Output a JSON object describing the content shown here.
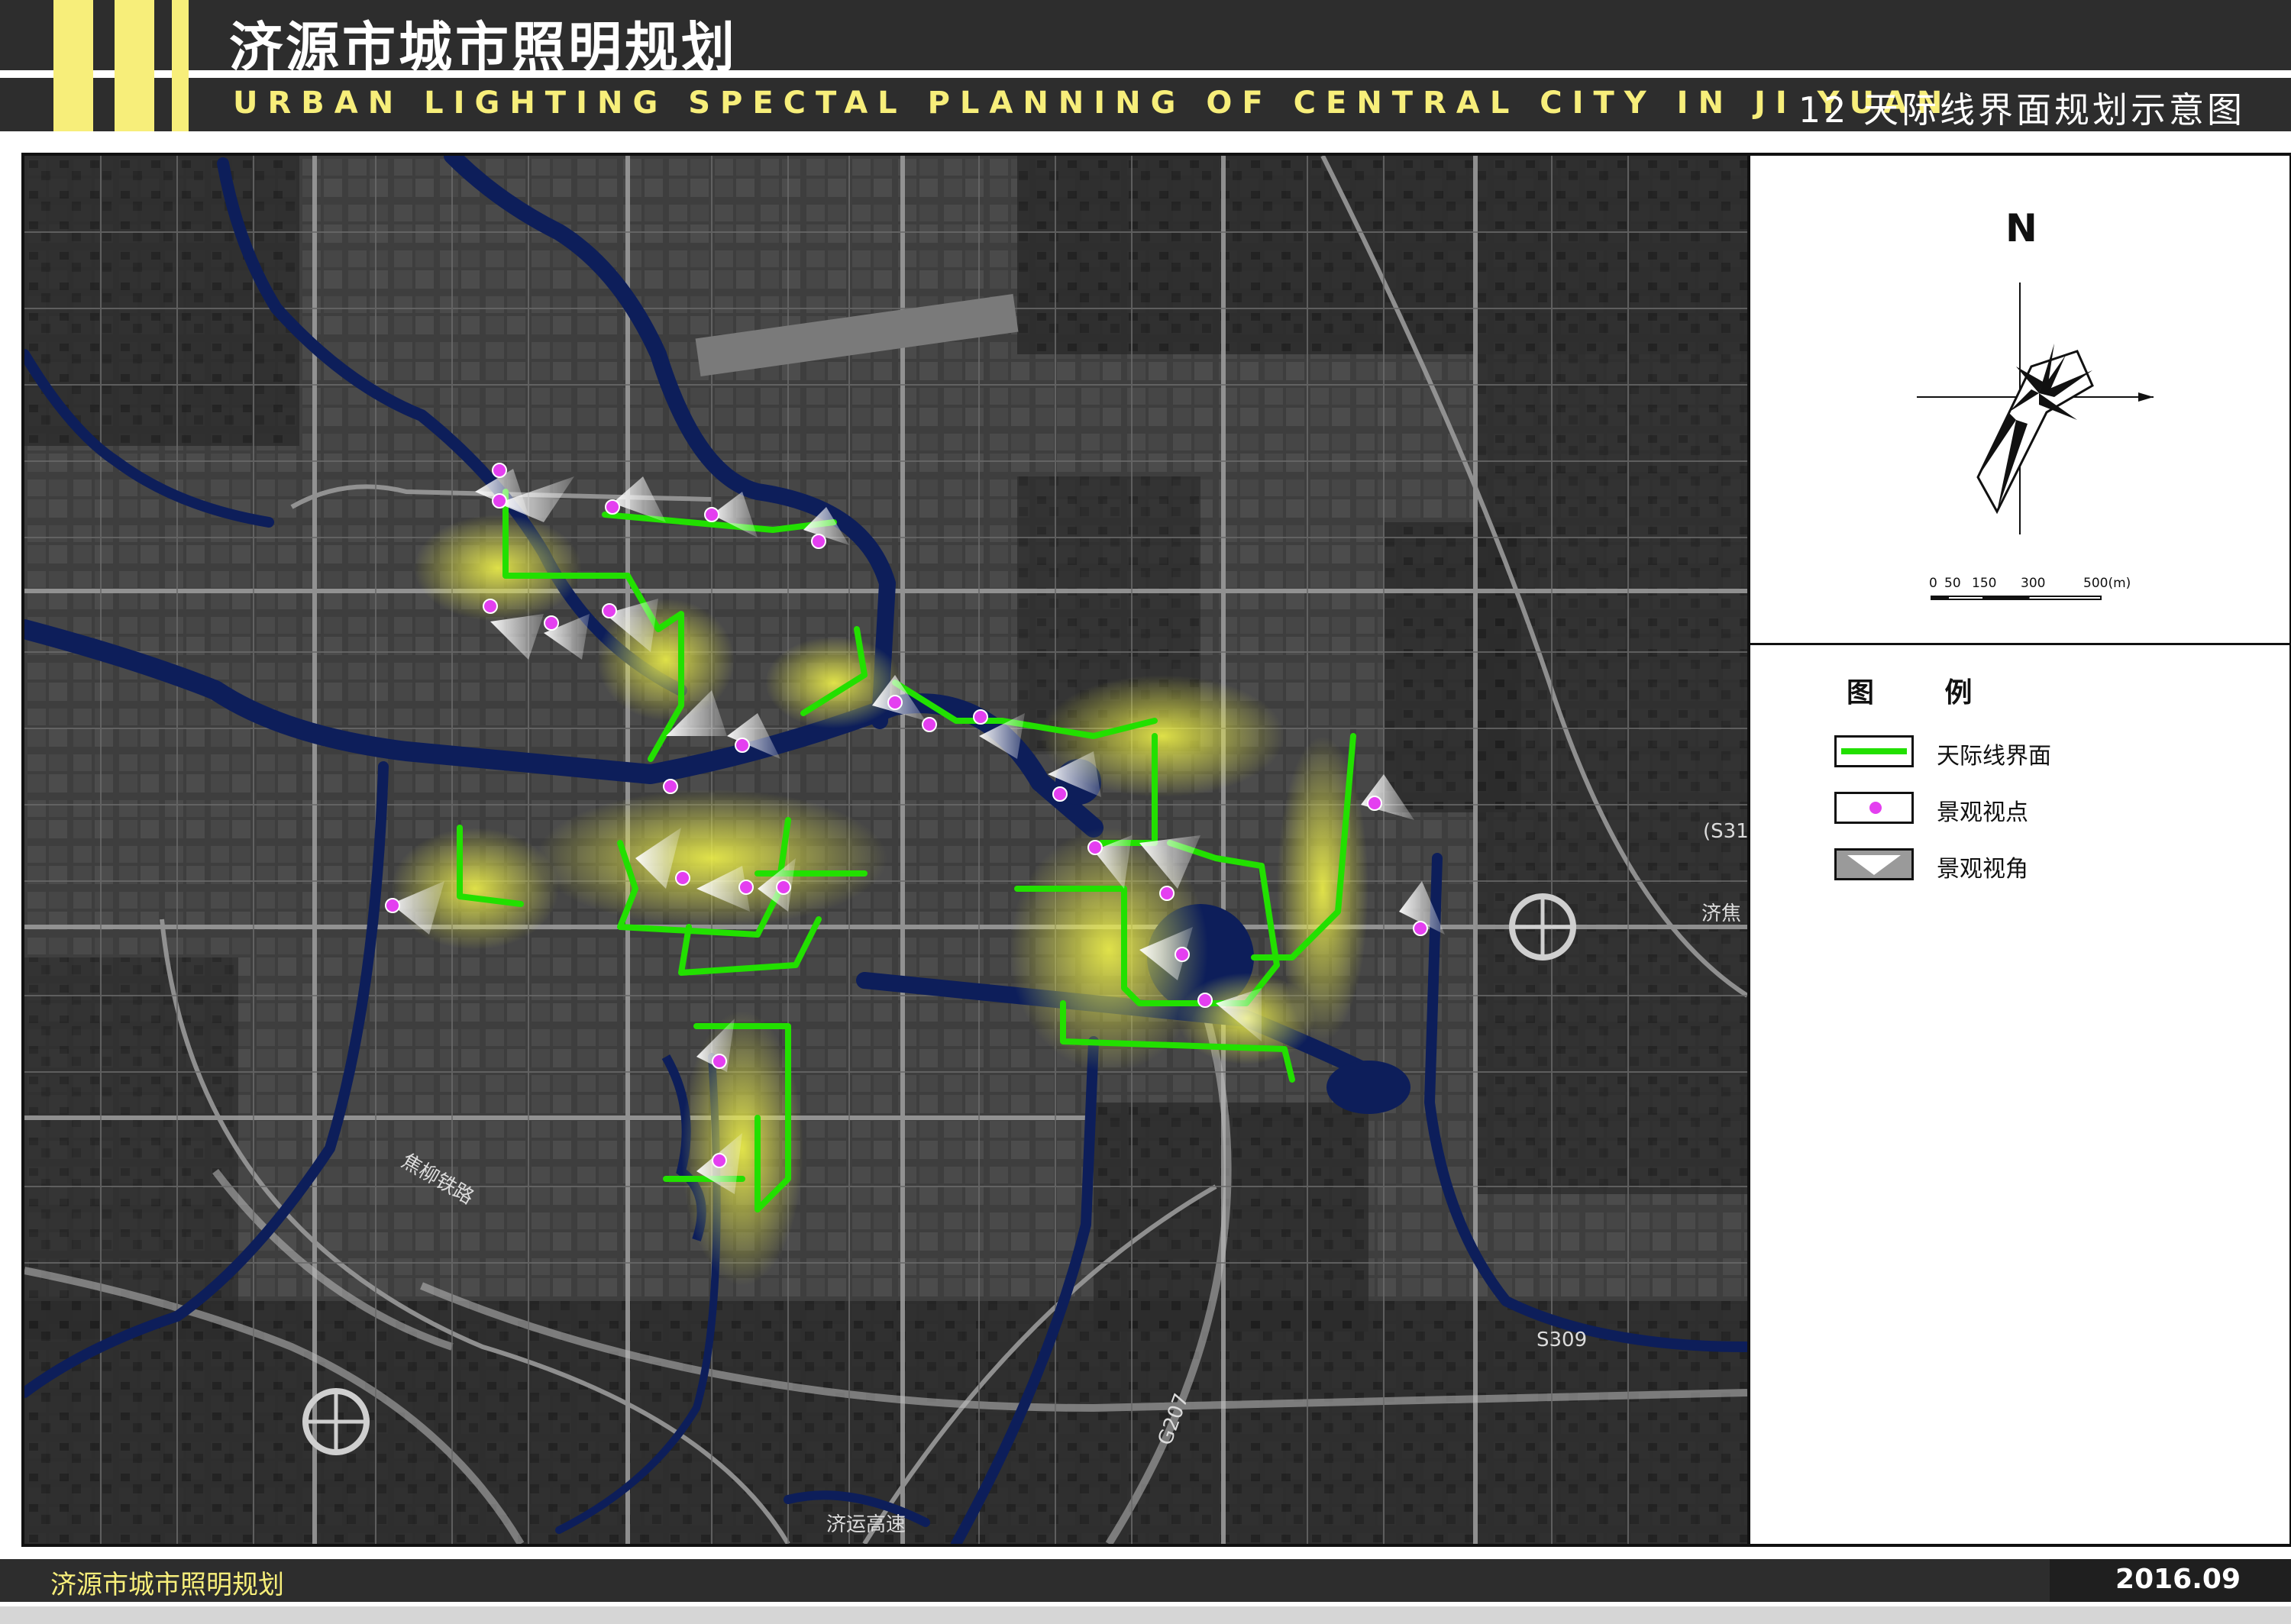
{
  "header": {
    "title": "济源市城市照明规划",
    "subtitle": "URBAN LIGHTING SPECTAL PLANNING OF CENTRAL CITY IN JI YUAN",
    "sheet": "12 天际线界面规划示意图"
  },
  "compass": {
    "north_label": "N"
  },
  "scale_bar": {
    "ticks": [
      "0",
      "50",
      "150",
      "300",
      "500(m)"
    ]
  },
  "legend": {
    "title": "图 例",
    "items": [
      {
        "label": "天际线界面",
        "symbol": "green-line",
        "color": "#22e000"
      },
      {
        "label": "景观视点",
        "symbol": "magenta-dot",
        "color": "#e43ff0"
      },
      {
        "label": "景观视角",
        "symbol": "view-cone",
        "color": "#c8c8c8"
      }
    ]
  },
  "map_labels": {
    "railway": "焦柳铁路",
    "road_s309": "S309",
    "road_g207": "G207",
    "expressway": "济运高速",
    "road_s31": "(S31",
    "road_jijiao": "济焦"
  },
  "colors": {
    "header_bg": "#2d2d2d",
    "accent_yellow": "#f7ee7a",
    "water": "#0d1e5a",
    "skyline_glow": "#e8ea3a"
  },
  "footer": {
    "left": "济源市城市照明规划",
    "date": "2016.09"
  }
}
